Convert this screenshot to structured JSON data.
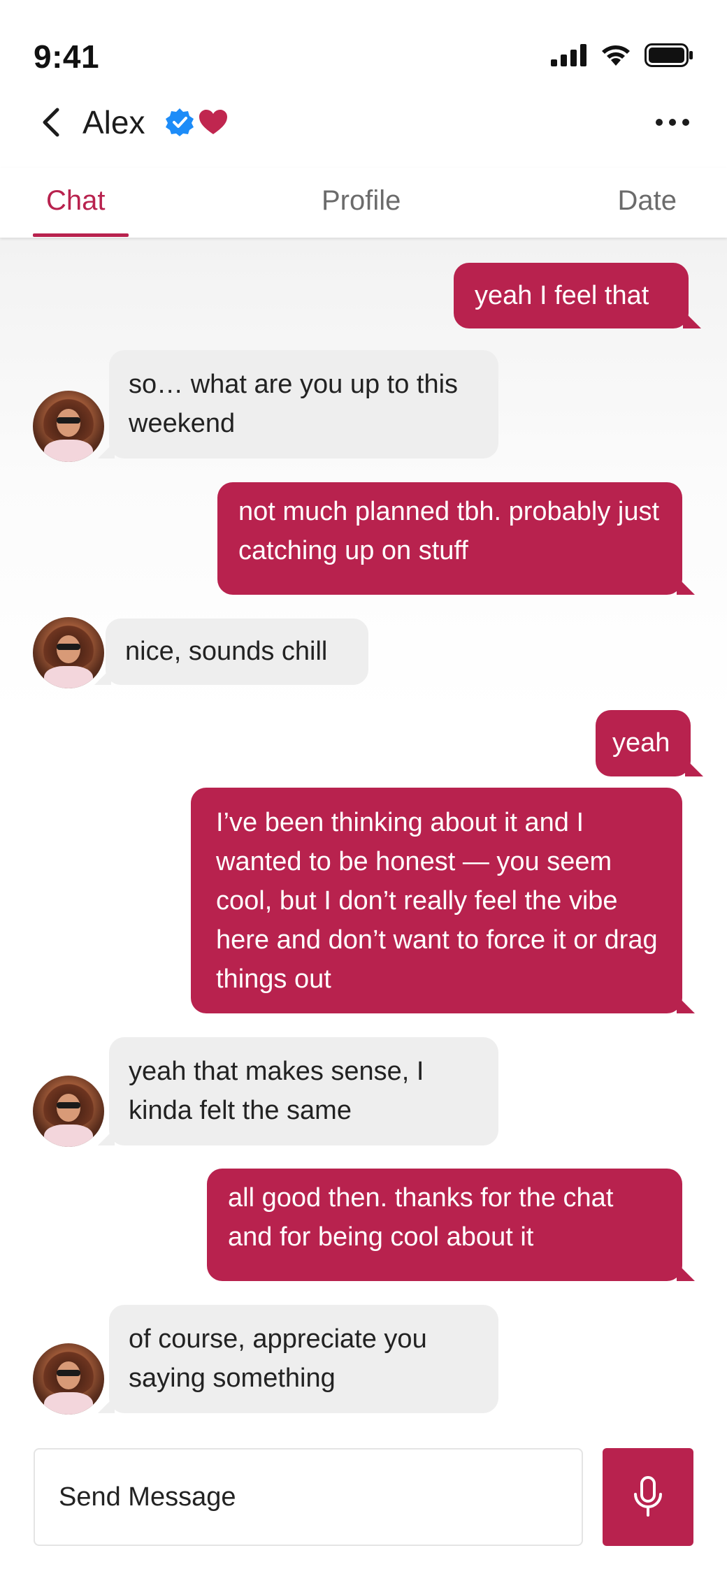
{
  "status_bar": {
    "time": "9:41",
    "icons": [
      "cellular-signal-icon",
      "wifi-icon",
      "battery-icon"
    ]
  },
  "header": {
    "contact_name": "Alex",
    "icons": [
      "back-icon",
      "verified-icon",
      "heart-icon",
      "more-icon"
    ]
  },
  "tabs": [
    {
      "label": "Chat",
      "active": true
    },
    {
      "label": "Profile",
      "active": false
    },
    {
      "label": "Date",
      "active": false
    }
  ],
  "messages": [
    {
      "sender": "me",
      "text": "yeah I feel that"
    },
    {
      "sender": "them",
      "text": "so… what are you up to this weekend"
    },
    {
      "sender": "me",
      "text": "not much planned tbh. probably just catching up on stuff"
    },
    {
      "sender": "them",
      "text": "nice, sounds chill"
    },
    {
      "sender": "me",
      "text": "yeah"
    },
    {
      "sender": "me",
      "text": "I’ve been thinking about it and I wanted to be honest — you seem cool, but I don’t really feel the vibe here and don’t want to force it or drag things out"
    },
    {
      "sender": "them",
      "text": "yeah that makes sense, I kinda felt the same"
    },
    {
      "sender": "me",
      "text": "all good then. thanks for the chat and for being cool about it"
    },
    {
      "sender": "them",
      "text": "of course, appreciate you saying something"
    }
  ],
  "composer": {
    "placeholder": "Send Message",
    "mic_icon": "microphone-icon"
  },
  "colors": {
    "accent": "#b8224e",
    "incoming_bubble": "#eeeeee",
    "verified": "#1d8cf8"
  }
}
